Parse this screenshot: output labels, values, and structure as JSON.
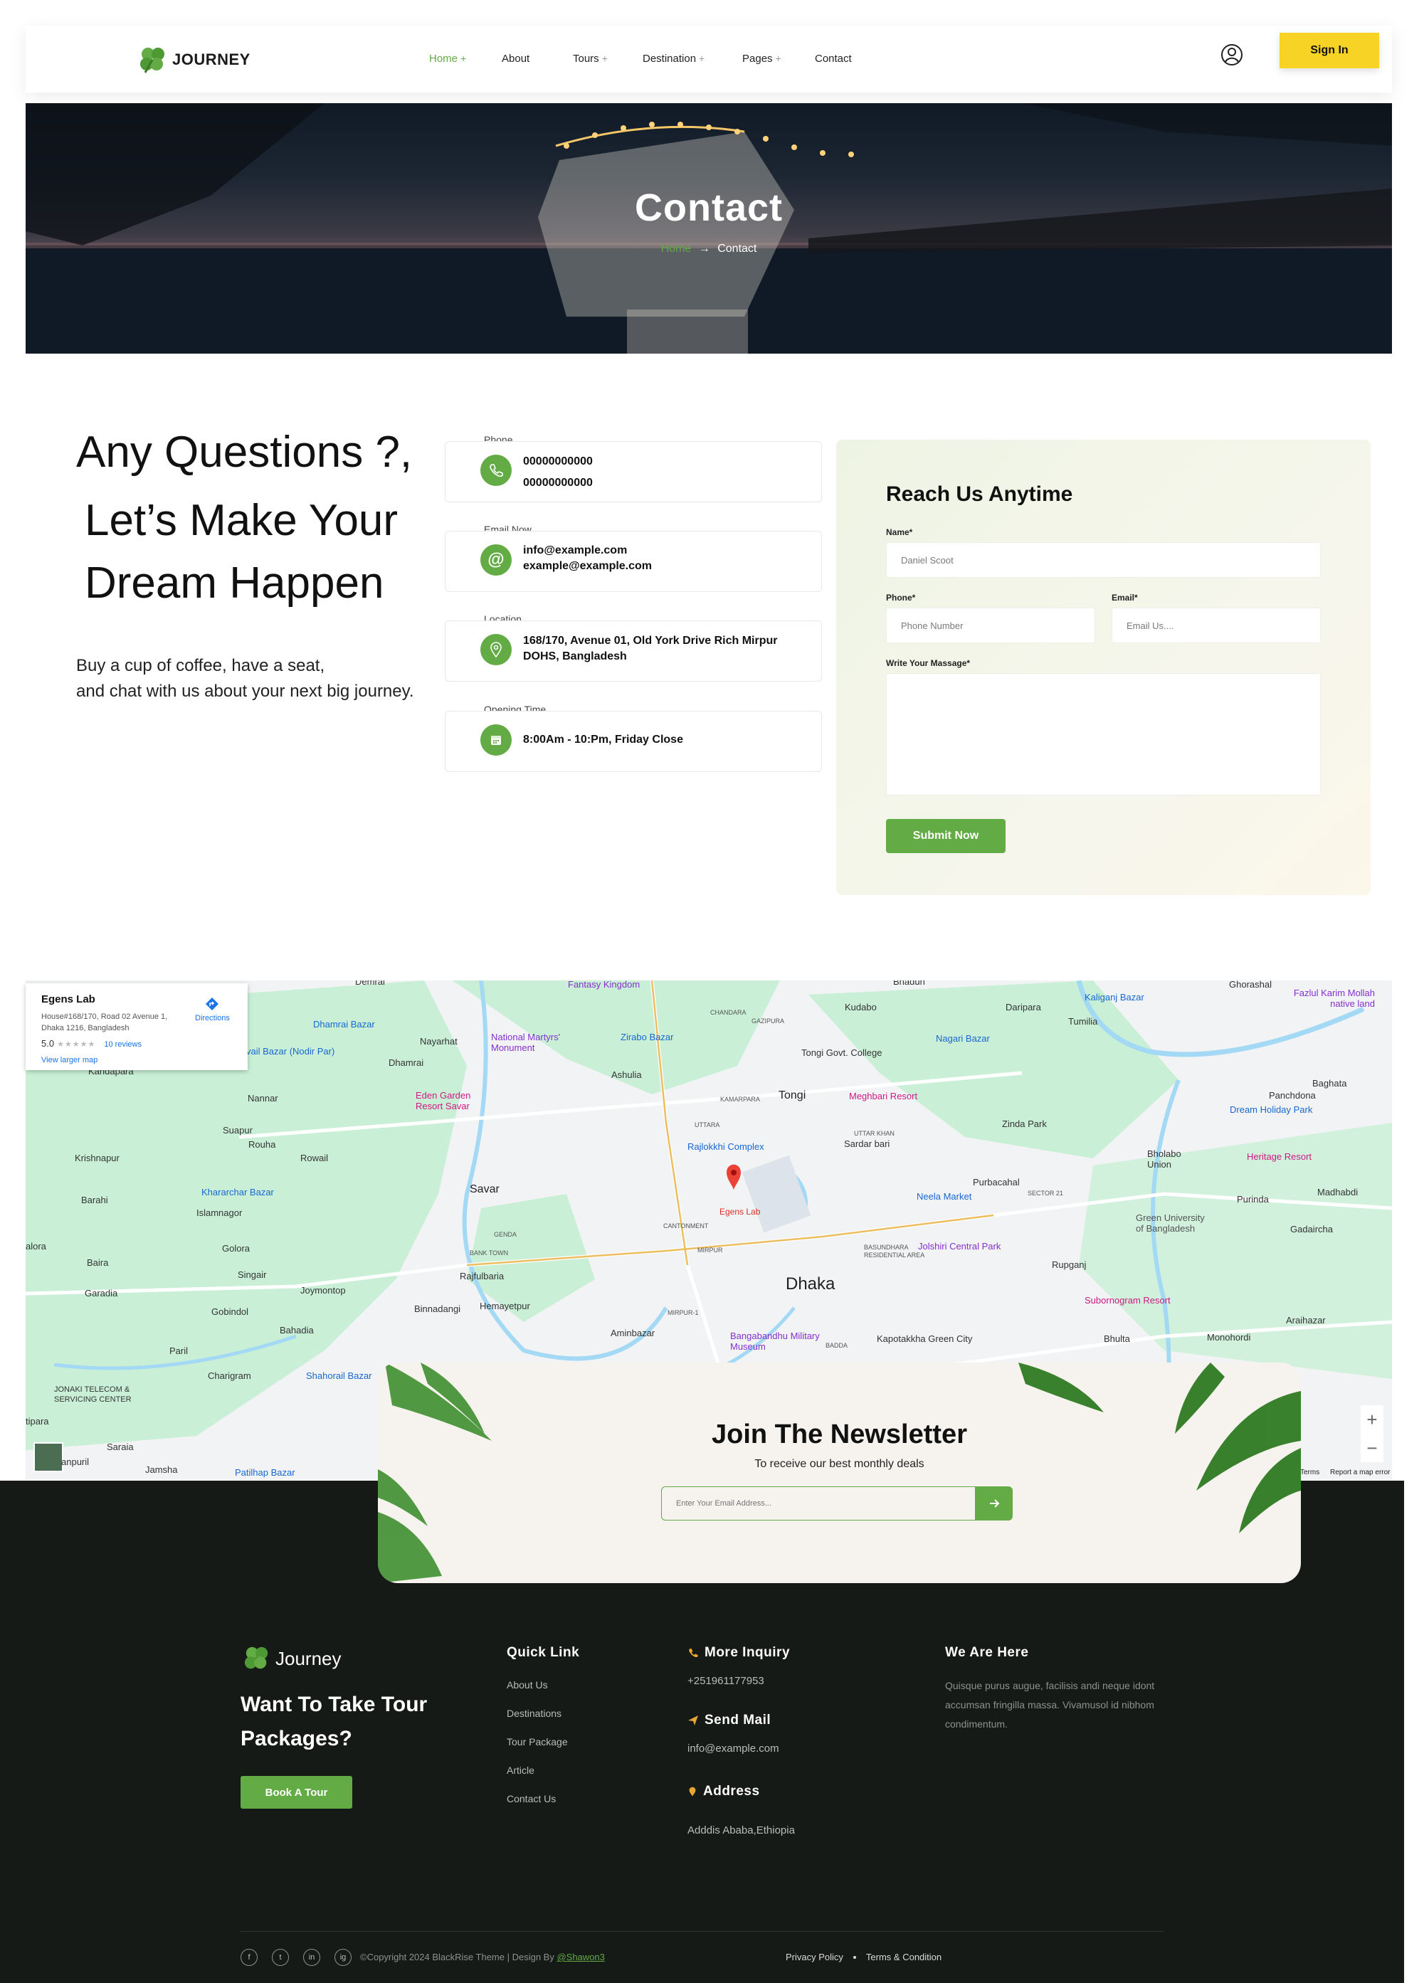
{
  "header": {
    "logo_text": "JOURNEY",
    "nav": [
      {
        "label": "Home",
        "dropdown": true,
        "active": true
      },
      {
        "label": "About",
        "dropdown": false
      },
      {
        "label": "Tours",
        "dropdown": true
      },
      {
        "label": "Destination",
        "dropdown": true
      },
      {
        "label": "Pages",
        "dropdown": true
      },
      {
        "label": "Contact",
        "dropdown": false
      }
    ],
    "plus": "+",
    "signin_label": "Sign In"
  },
  "hero": {
    "title": "Contact",
    "breadcrumb_home": "Home",
    "breadcrumb_arrow": "→",
    "breadcrumb_current": "Contact"
  },
  "intro": {
    "line1": "Any Questions ?,",
    "line2": "Let’s Make Your",
    "line3": "Dream Happen",
    "sub1": "Buy a  cup of coffee, have a seat,",
    "sub2": "and chat with us about your next big journey."
  },
  "contact_info": {
    "phone": {
      "label": "Phone",
      "values": [
        "00000000000",
        "00000000000"
      ]
    },
    "email": {
      "label": "Email Now",
      "values": [
        "info@example.com",
        "example@example.com"
      ]
    },
    "location": {
      "label": "Location",
      "values": [
        "168/170, Avenue 01, Old York Drive Rich Mirpur",
        "DOHS, Bangladesh"
      ]
    },
    "hours": {
      "label": "Opening Time",
      "values": [
        "8:00Am - 10:Pm, Friday Close"
      ]
    }
  },
  "form": {
    "title": "Reach Us Anytime",
    "name_label": "Name*",
    "name_placeholder": "Daniel Scoot",
    "phone_label": "Phone*",
    "phone_placeholder": "Phone Number",
    "email_label": "Email*",
    "email_placeholder": "Email Us....",
    "message_label": "Write Your Massage*",
    "submit_label": "Submit Now"
  },
  "map": {
    "card_title": "Egens Lab",
    "card_address": "House#168/170, Road 02 Avenue 1, Dhaka 1216, Bangladesh",
    "rating": "5.0",
    "stars": "★★★★★",
    "reviews": "10 reviews",
    "larger_map": "View larger map",
    "directions": "Directions",
    "pin_label": "Egens Lab",
    "labels": {
      "dhaka": "Dhaka",
      "savar": "Savar",
      "tongi": "Tongi",
      "nannar": "Nannar",
      "suapur": "Suapur",
      "rouha": "Rouha",
      "krishnapur": "Krishnapur",
      "rowail": "Rowail",
      "barahi": "Barahi",
      "islamnagor": "Islamnagor",
      "golora": "Golora",
      "baira": "Baira",
      "singair": "Singair",
      "garadia": "Garadia",
      "joymontop": "Joymontop",
      "gobindol": "Gobindol",
      "bahadia": "Bahadia",
      "paril": "Paril",
      "charigram": "Charigram",
      "saraia": "Saraia",
      "jamsha": "Jamsha",
      "kandapara": "Kandapara",
      "nayarhat": "Nayarhat",
      "dhamrai": "Dhamrai",
      "ashulia": "Ashulia",
      "kudabo": "Kudabo",
      "daripara": "Daripara",
      "tumilia": "Tumilia",
      "bhadun": "Bhadun",
      "ghorashal": "Ghorashal",
      "baghata": "Baghata",
      "panchdona": "Panchdona",
      "purbacahal": "Purbacahal",
      "rupganj": "Rupganj",
      "bhulta": "Bhulta",
      "purinda": "Purinda",
      "gadaircha": "Gadaircha",
      "madhabdi": "Madhabdi",
      "araihazar": "Araihazar",
      "monohordi": "Monohordi",
      "binnadangi": "Binnadangi",
      "hemayetpur": "Hemayetpur",
      "rajfulbaria": "Rajfulbaria",
      "aminbazar": "Aminbazar",
      "mirpur": "MIRPUR",
      "cantonment": "CANTONMENT",
      "uttara": "UTTARA",
      "kamarpara": "KAMARPARA",
      "chandara": "CHANDARA",
      "gazipura": "GAZIPURA",
      "sardar_bari": "Sardar bari",
      "zinda_park": "Zinda Park",
      "neela_market": "Neela Market",
      "jolshiri": "Jolshiri Central Park",
      "kapotakkha": "Kapotakkha Green City",
      "bangabandhu": "Bangabandhu Military Museum",
      "subornogram": "Subornogram Resort",
      "dream_holiday": "Dream Holiday Park",
      "heritage": "Heritage Resort",
      "meghbari": "Meghbari Resort",
      "nagari": "Nagari Bazar",
      "kaliganj": "Kaliganj Bazar",
      "fazlul": "Fazlul Karim Mollah native land",
      "fantasy": "Fantasy Kingdom",
      "martyrs": "National Martyrs' Monument",
      "zirabo": "Zirabo Bazar",
      "rajlokkhi": "Rajlokkhi Complex",
      "tongi_college": "Tongi Govt. College",
      "eden": "Eden Garden Resort Savar",
      "dhamrai_bazar": "Dhamrai Bazar",
      "nodir_par": "vail Bazar (Nodir Par)",
      "kharar": "Khararchar Bazar",
      "shahorail": "Shahorail Bazar",
      "jonaki": "JONAKI TELECOM & SERVICING CENTER",
      "patilhap": "Patilhap Bazar",
      "alora": "alora",
      "tipara": "tipara",
      "anpuril": "anpuril",
      "green_univ": "Green University of Bangladesh",
      "bholabo": "Bholabo Union",
      "uttar_khan": "UTTAR KHAN",
      "bashundhara": "BASUNDHARA RESIDENTIAL AREA",
      "genda": "GENDA",
      "bank_town": "BANK TOWN",
      "mirpur1": "MIRPUR-1",
      "badda": "BADDA",
      "sector21": "SECTOR 21",
      "dhamrai_top": "Demrai"
    },
    "terms": "Terms",
    "report": "Report a map error",
    "zoom_in": "+",
    "zoom_out": "−"
  },
  "newsletter": {
    "title": "Join The Newsletter",
    "subtitle": "To receive our best monthly deals",
    "placeholder": "Enter Your Email Address..."
  },
  "footer": {
    "logo_text": "Journey",
    "tagline": "Want To Take Tour Packages?",
    "book_label": "Book A Tour",
    "quick_title": "Quick Link",
    "quick_links": [
      "About Us",
      "Destinations",
      "Tour Package",
      "Article",
      "Contact Us"
    ],
    "inquiry_title": "More Inquiry",
    "inquiry_phone": "+251961177953",
    "mail_title": "Send Mail",
    "mail_value": "info@example.com",
    "address_title": "Address",
    "address_value": "Adddis Ababa,Ethiopia",
    "here_title": "We Are Here",
    "here_text": "Quisque purus augue, facilisis andi neque idont accumsan fringilla massa. Vivamusol id nibhom condimentum.",
    "copyright": "©Copyright 2024 BlackRise Theme | Design By ",
    "designer": "@Shawon3",
    "privacy": "Privacy Policy",
    "terms": "Terms & Condition",
    "social": [
      "f",
      "t",
      "in",
      "ig"
    ]
  },
  "colors": {
    "accent": "#63ab45",
    "signin": "#f7d325",
    "footer_bg": "#151a16"
  }
}
